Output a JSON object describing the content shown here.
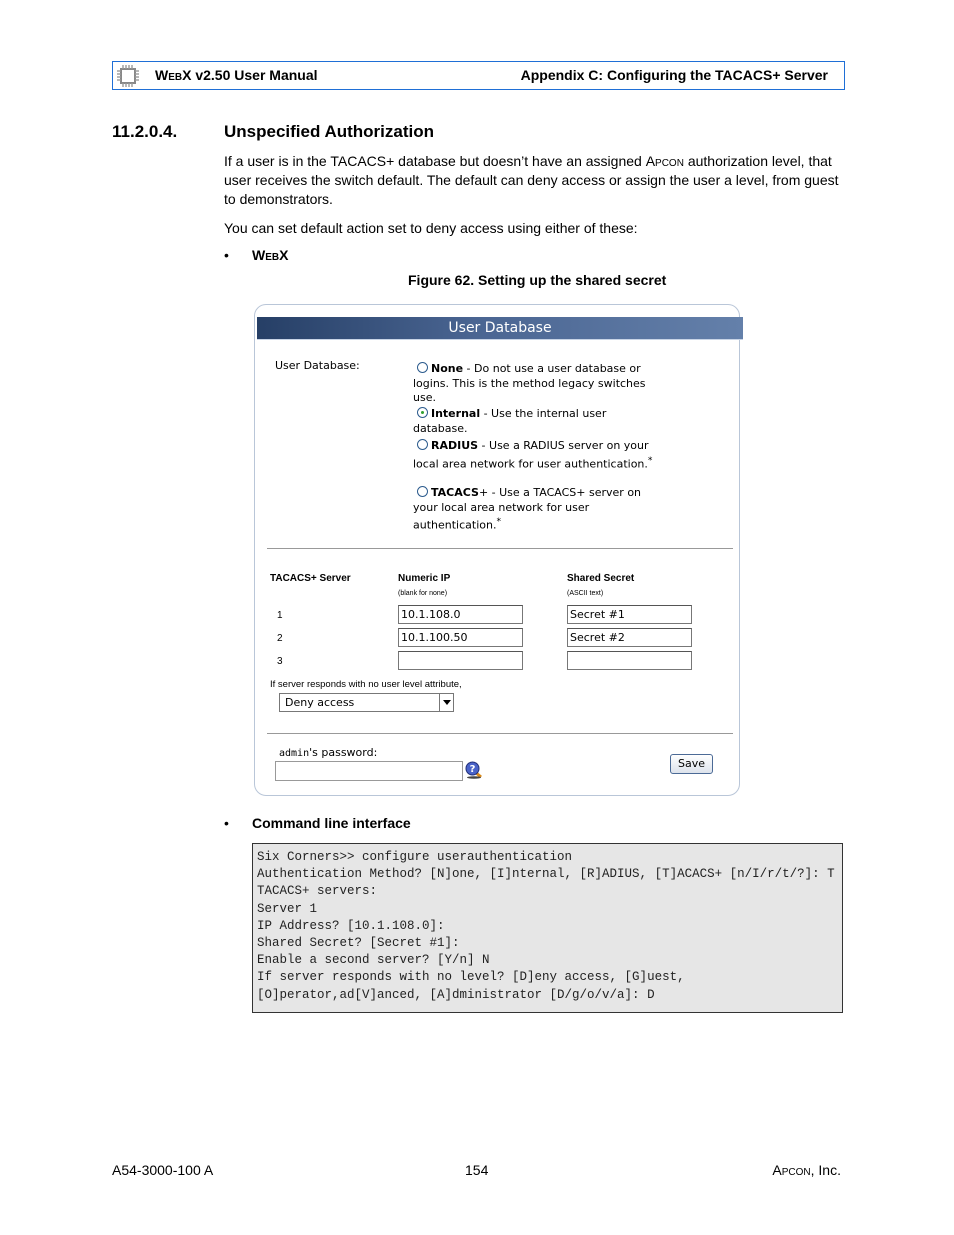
{
  "header": {
    "product_sc": "WebX",
    "product_rest": " v2.50 User Manual",
    "chapter": "Appendix C: Configuring the TACACS+ Server"
  },
  "section": {
    "number": "11.2.0.4.",
    "title": "Unspecified Authorization",
    "para1_a": "If a user is in the TACACS+ database but doesn’t have an assigned ",
    "para1_brand": "Apcon",
    "para1_b": " authorization level, that user receives the switch default. The default can deny access or assign the user a level, from guest to demonstrators.",
    "para2": "You can set default action set to deny access using either of these:",
    "bullet_symbol": "•",
    "bullet1": "WebX",
    "figure_caption": "Figure 62. Setting up the shared secret",
    "bullet2": "Command line interface"
  },
  "panel": {
    "title": "User Database",
    "field_label": "User Database:",
    "options": [
      {
        "name": "None",
        "desc": " - Do not use a user database or logins. This is the method legacy switches use.",
        "checked": false
      },
      {
        "name": "Internal",
        "desc": " - Use the internal user database.",
        "checked": true
      },
      {
        "name": "RADIUS",
        "desc": " - Use a RADIUS server on your local area network for user authentication.",
        "sup": "*",
        "checked": false
      },
      {
        "name": "TACACS",
        "name_suffix": "+",
        "desc": " - Use a TACACS+ server on your local area network for user authentication.",
        "sup": "*",
        "checked": false
      }
    ],
    "servers": {
      "col_server": "TACACS+ Server",
      "col_ip": "Numeric IP",
      "col_ip_hint": "(blank for none)",
      "col_secret": "Shared Secret",
      "col_secret_hint": "(ASCII text)",
      "rows": [
        {
          "num": "1",
          "ip": "10.1.108.0",
          "secret": "Secret #1"
        },
        {
          "num": "2",
          "ip": "10.1.100.50",
          "secret": "Secret #2"
        },
        {
          "num": "3",
          "ip": "",
          "secret": ""
        }
      ]
    },
    "no_level_label": "If server responds with no user level attribute,",
    "no_level_selected": "Deny access",
    "admin_label_mono": "admin",
    "admin_label_rest": "'s password:",
    "save_label": "Save"
  },
  "cli": {
    "lines": [
      "Six Corners>> configure userauthentication",
      "Authentication Method? [N]one, [I]nternal, [R]ADIUS, [T]ACACS+ [n/I/r/t/?]: T",
      "TACACS+ servers:",
      "Server 1",
      "IP Address? [10.1.108.0]:",
      "Shared Secret? [Secret #1]:",
      "Enable a second server? [Y/n] N",
      "If server responds with no level? [D]eny access, [G]uest,",
      "[O]perator,ad[V]anced, [A]dministrator [D/g/o/v/a]: D"
    ]
  },
  "footer": {
    "doc_number": "A54-3000-100 A",
    "page_number": "154",
    "company_sc": "Apcon",
    "company_rest": ", Inc."
  }
}
